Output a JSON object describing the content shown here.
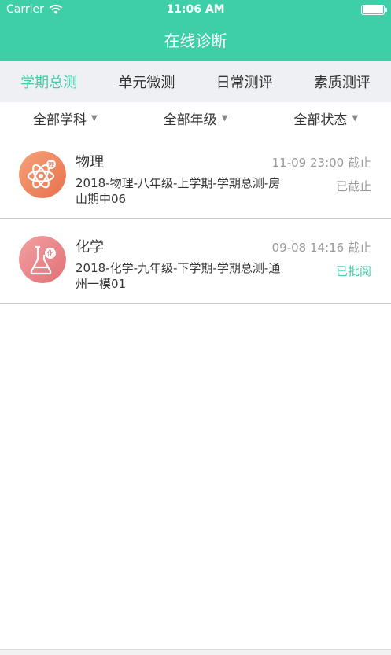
{
  "status_bar": {
    "carrier": "Carrier",
    "time": "11:06 AM"
  },
  "nav": {
    "title": "在线诊断"
  },
  "tabs": [
    {
      "label": "学期总测",
      "active": true
    },
    {
      "label": "单元微测",
      "active": false
    },
    {
      "label": "日常测评",
      "active": false
    },
    {
      "label": "素质测评",
      "active": false
    }
  ],
  "filters": [
    {
      "label": "全部学科"
    },
    {
      "label": "全部年级"
    },
    {
      "label": "全部状态"
    }
  ],
  "items": [
    {
      "subject": "物理",
      "icon": "atom-icon",
      "icon_color": "#f08b63",
      "name": "2018-物理-八年级-上学期-学期总测-房山期中06",
      "deadline": "11-09 23:00 截止",
      "status": "已截止",
      "status_color": "#999999"
    },
    {
      "subject": "化学",
      "icon": "flask-icon",
      "icon_color": "#e9848a",
      "name": "2018-化学-九年级-下学期-学期总测-通州一模01",
      "deadline": "09-08 14:16 截止",
      "status": "已批阅",
      "status_color": "#3fcfa8"
    }
  ],
  "colors": {
    "accent": "#3fcfa8",
    "tab_bar_bg": "#eef0f3"
  }
}
